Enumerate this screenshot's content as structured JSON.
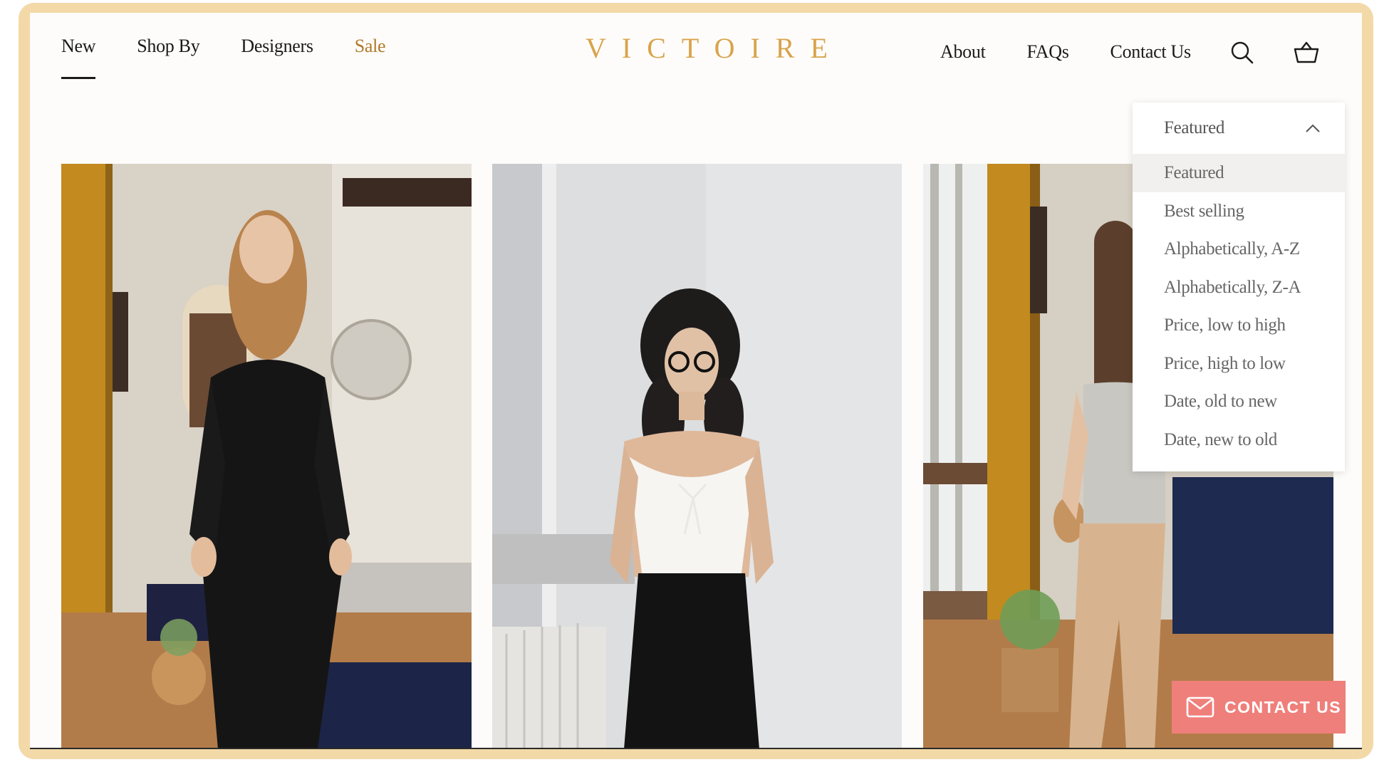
{
  "nav": {
    "left": [
      {
        "label": "New"
      },
      {
        "label": "Shop By"
      },
      {
        "label": "Designers"
      },
      {
        "label": "Sale"
      }
    ],
    "right": [
      {
        "label": "About"
      },
      {
        "label": "FAQs"
      },
      {
        "label": "Contact Us"
      }
    ],
    "search_icon": "search-icon",
    "basket_icon": "basket-icon"
  },
  "brand": {
    "logo_text": "VICTOIRE",
    "accent_color": "#d9a34b",
    "sale_color": "#b07a2a"
  },
  "sort": {
    "selected_label": "Featured",
    "options": [
      {
        "label": "Featured"
      },
      {
        "label": "Best selling"
      },
      {
        "label": "Alphabetically, A-Z"
      },
      {
        "label": "Alphabetically, Z-A"
      },
      {
        "label": "Price, low to high"
      },
      {
        "label": "Price, high to low"
      },
      {
        "label": "Date, old to new"
      },
      {
        "label": "Date, new to old"
      }
    ]
  },
  "products": [
    {
      "image": "woman-in-black-knit-dress"
    },
    {
      "image": "woman-in-white-camisole-and-black-skirt"
    },
    {
      "image": "person-in-grey-top-and-beige-trousers"
    }
  ],
  "contact_widget": {
    "label": "CONTACT US",
    "icon": "mail-icon",
    "color": "#ef7f7a"
  }
}
